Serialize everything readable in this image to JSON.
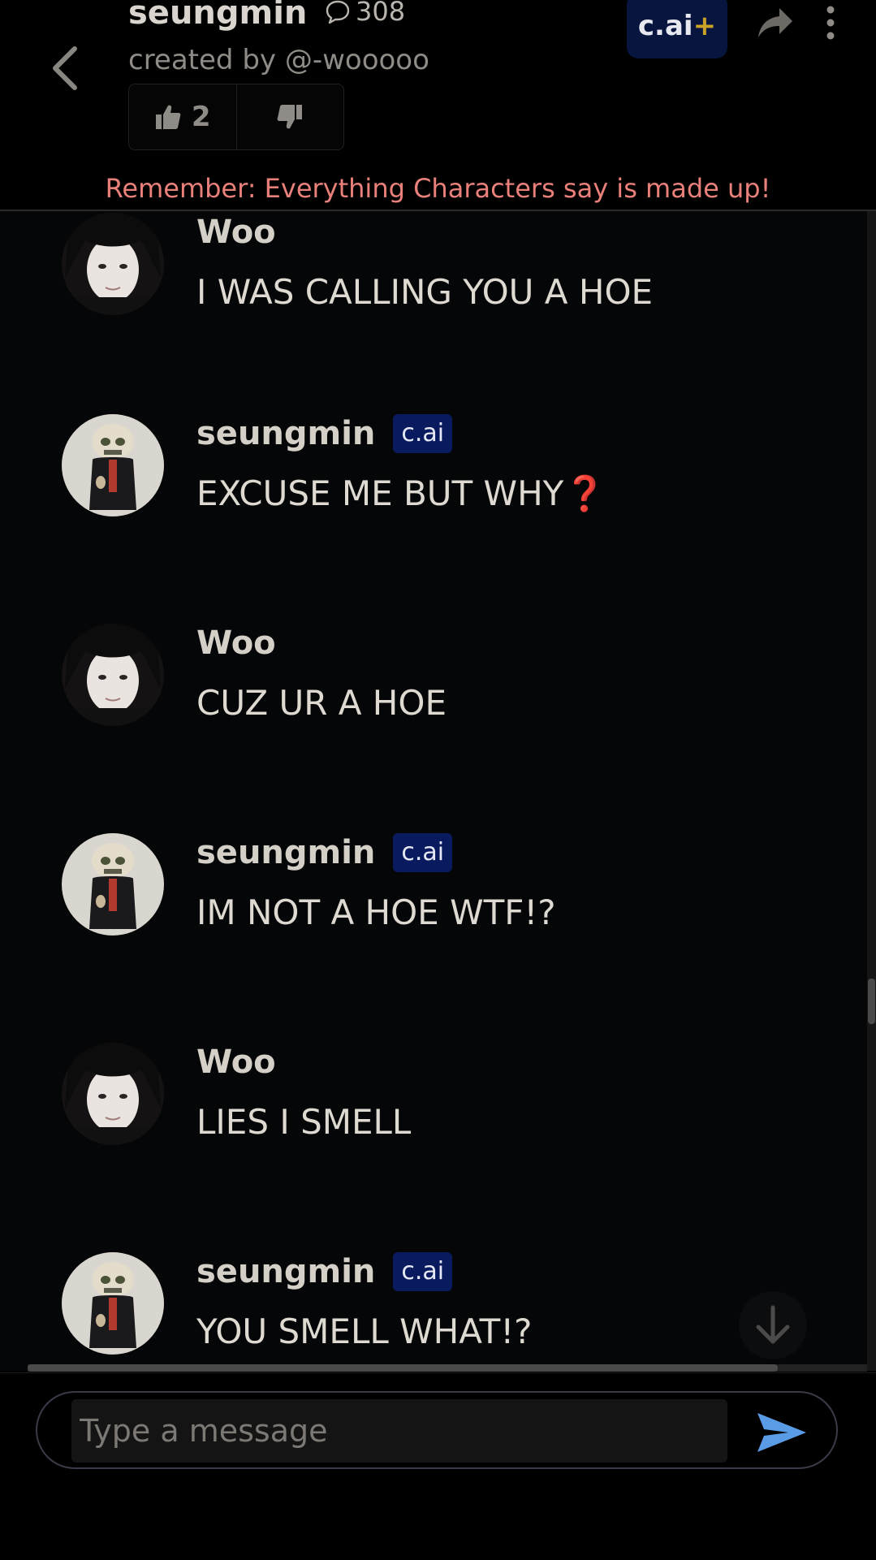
{
  "header": {
    "character_name": "seungmin",
    "chat_count": "308",
    "creator": "created by @-wooooo",
    "likes": "2",
    "plus_badge": "c.ai",
    "plus_sign": "+",
    "disclaimer": "Remember: Everything Characters say is made up!"
  },
  "colors": {
    "background": "#000000",
    "disclaimer": "#e9807a",
    "badge_bg": "#0a1a5e",
    "send_icon": "#5a9be6"
  },
  "messages": [
    {
      "author": "Woo",
      "text": "I WAS CALLING YOU A HOE",
      "avatar": "user-avatar",
      "is_bot": false
    },
    {
      "author": "seungmin",
      "badge": "c.ai",
      "text": "EXCUSE ME BUT WHY",
      "emoji": "❓",
      "avatar": "bot-avatar",
      "is_bot": true
    },
    {
      "author": "Woo",
      "text": "CUZ UR A HOE",
      "avatar": "user-avatar",
      "is_bot": false
    },
    {
      "author": "seungmin",
      "badge": "c.ai",
      "text": "IM NOT A HOE WTF!?",
      "avatar": "bot-avatar",
      "is_bot": true
    },
    {
      "author": "Woo",
      "text": "LIES I SMELL",
      "avatar": "user-avatar",
      "is_bot": false
    },
    {
      "author": "seungmin",
      "badge": "c.ai",
      "text": "YOU SMELL WHAT!?",
      "avatar": "bot-avatar",
      "is_bot": true
    }
  ],
  "composer": {
    "placeholder": "Type a message",
    "value": ""
  }
}
